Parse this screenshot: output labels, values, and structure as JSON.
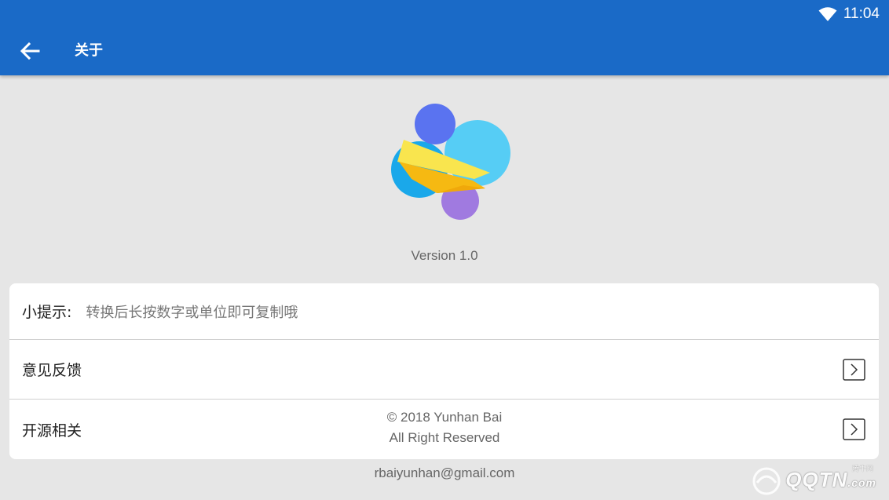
{
  "status_bar": {
    "time": "11:04",
    "wifi_icon": "wifi-icon"
  },
  "app_bar": {
    "title": "关于",
    "back_icon": "arrow-left-icon",
    "color": "#1a6ac7"
  },
  "logo": {
    "icon": "app-logo-icon"
  },
  "version": "Version 1.0",
  "card": {
    "tip": {
      "label": "小提示:",
      "text": "转换后长按数字或单位即可复制哦"
    },
    "feedback": {
      "label": "意见反馈",
      "chevron_icon": "chevron-right-icon"
    },
    "open_source": {
      "label": "开源相关",
      "chevron_icon": "chevron-right-icon"
    }
  },
  "copyright": {
    "line1": "© 2018 Yunhan Bai",
    "line2": "All Right Reserved"
  },
  "email": "rbaiyunhan@gmail.com",
  "watermark": {
    "brand": "QQTN",
    "suffix": ".com",
    "small": "腾牛网"
  }
}
